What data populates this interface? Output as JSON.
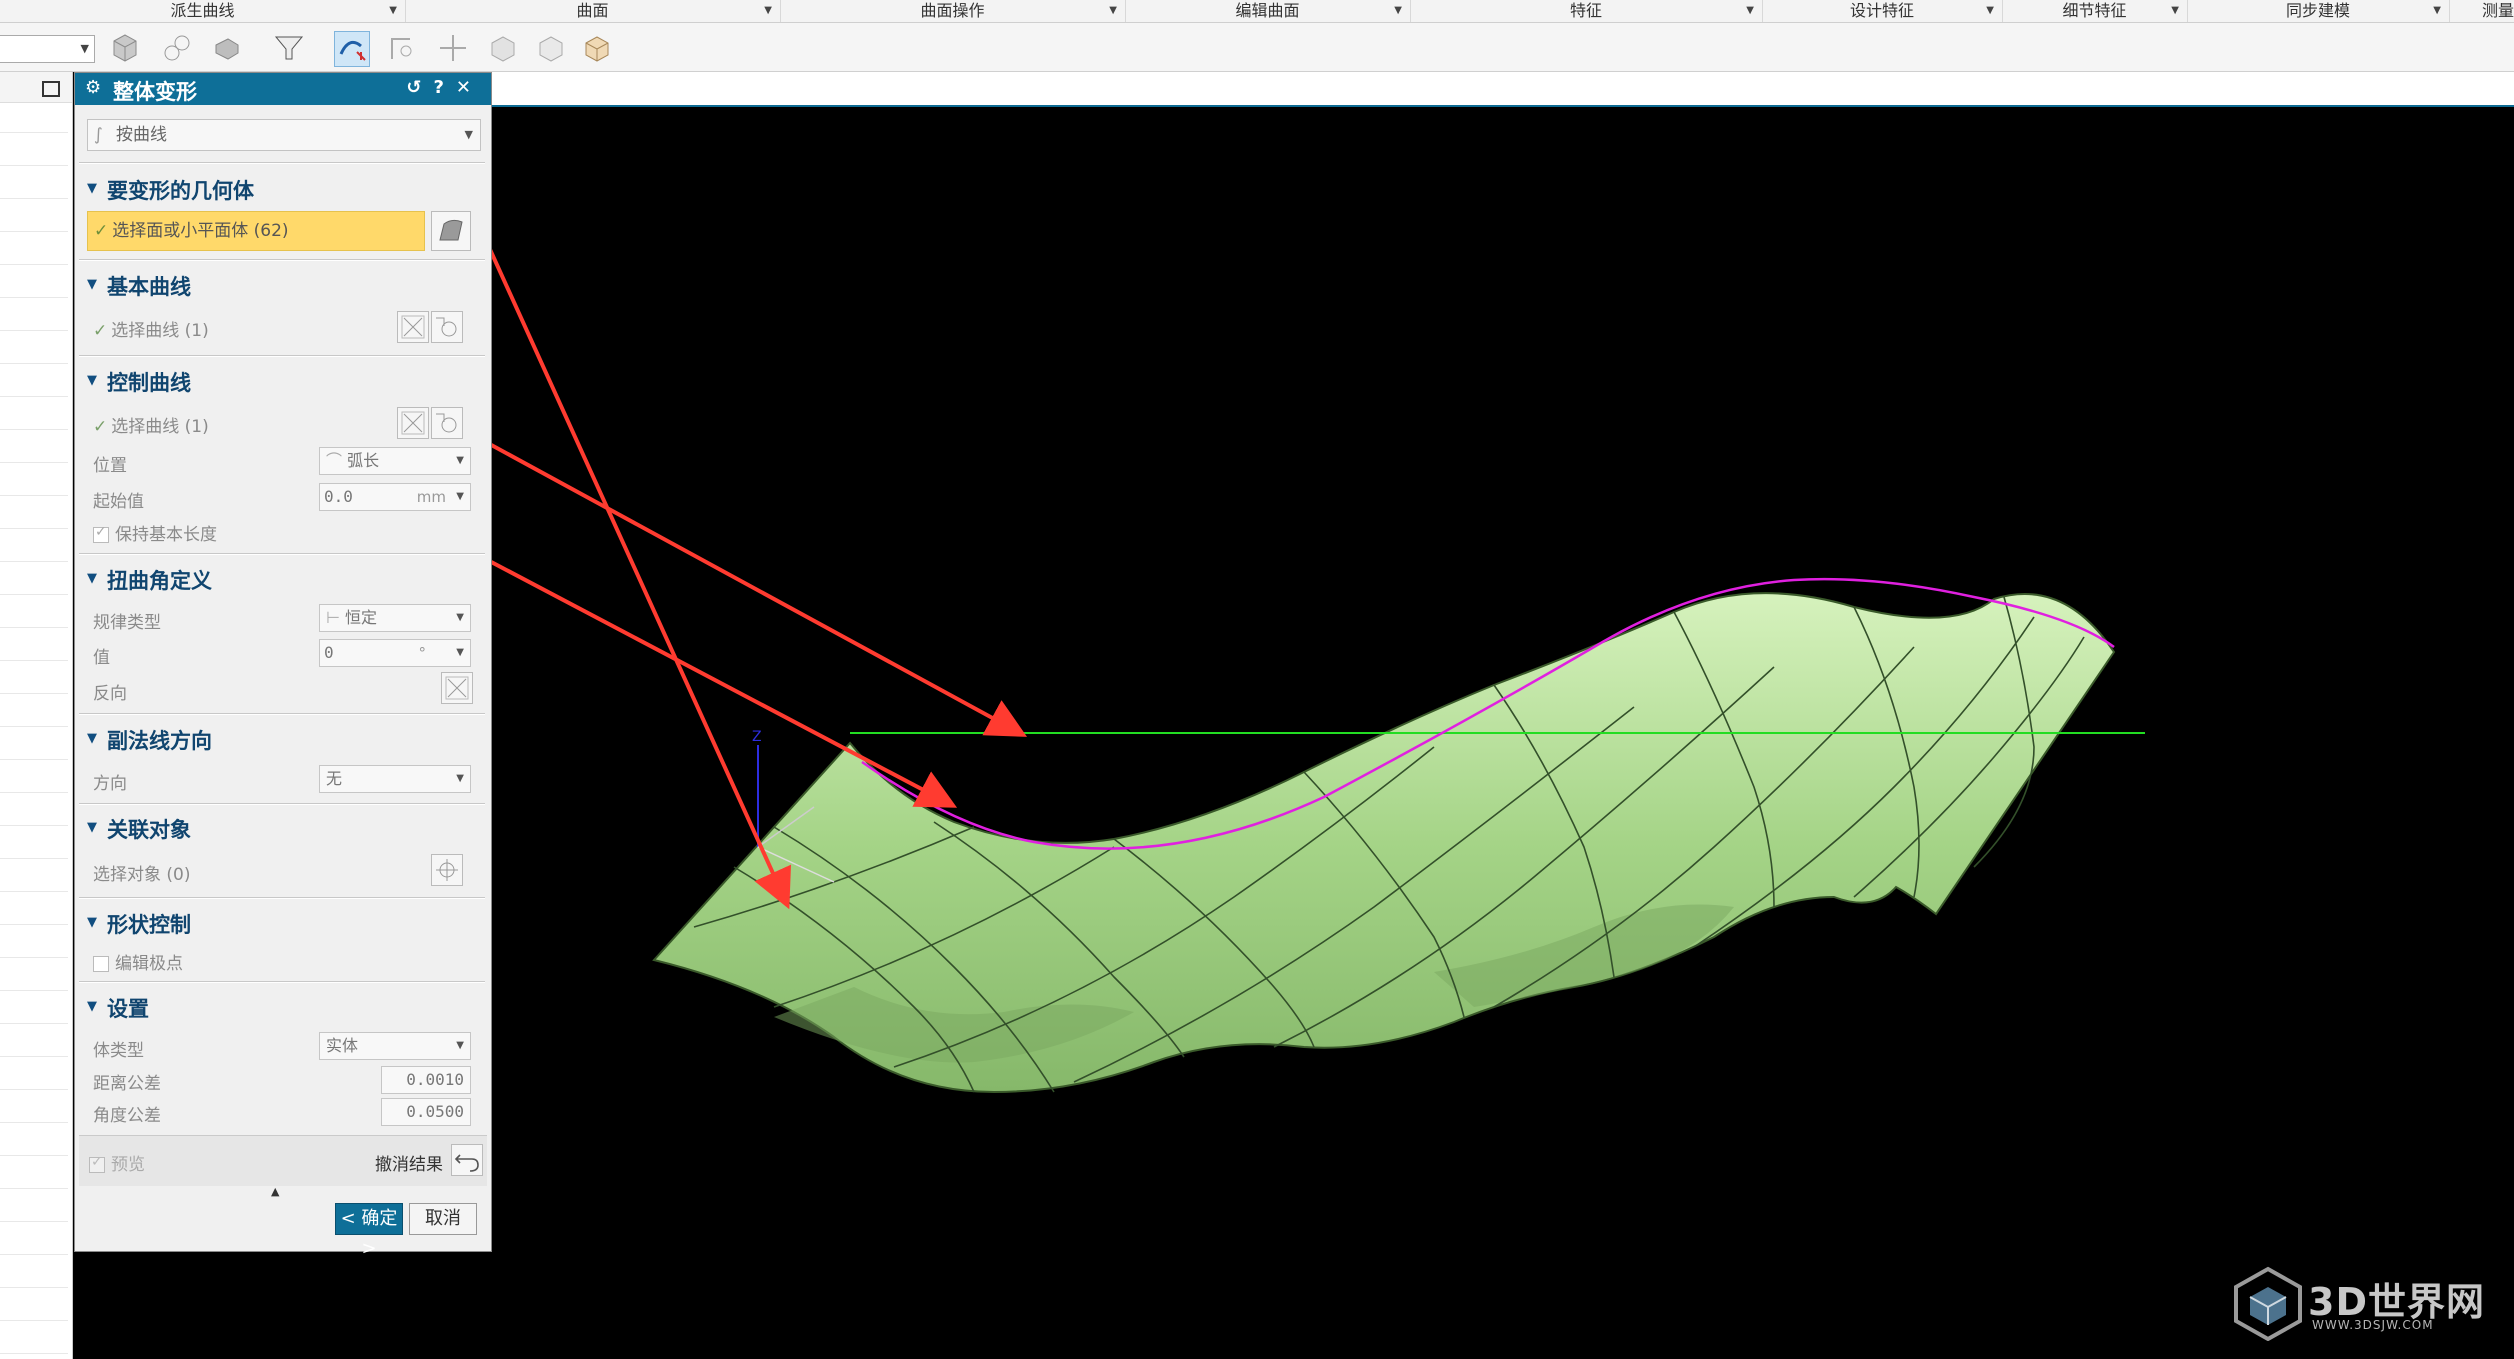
{
  "ribbon": {
    "groups": [
      "派生曲线",
      "曲面",
      "曲面操作",
      "编辑曲面",
      "特征",
      "设计特征",
      "细节特征",
      "同步建模",
      "测量"
    ]
  },
  "dialog": {
    "title": "整体变形",
    "title_buttons": [
      "↺",
      "?",
      "✕"
    ],
    "type_value": "按曲线",
    "sections": {
      "geometry": {
        "title": "要变形的几何体",
        "select_label": "选择面或小平面体 (62)"
      },
      "base_curve": {
        "title": "基本曲线",
        "select_label": "选择曲线 (1)"
      },
      "control_curve": {
        "title": "控制曲线",
        "select_label": "选择曲线 (1)",
        "position_label": "位置",
        "position_value": "弧长",
        "start_label": "起始值",
        "start_value": "0.0",
        "start_unit": "mm",
        "keep_length_label": "保持基本长度"
      },
      "twist": {
        "title": "扭曲角定义",
        "law_label": "规律类型",
        "law_value": "恒定",
        "value_label": "值",
        "value_value": "0",
        "value_unit": "°",
        "reverse_label": "反向"
      },
      "binormal": {
        "title": "副法线方向",
        "direction_label": "方向",
        "direction_value": "无"
      },
      "associated": {
        "title": "关联对象",
        "select_label": "选择对象 (0)"
      },
      "shape_control": {
        "title": "形状控制",
        "edit_poles_label": "编辑极点"
      },
      "settings": {
        "title": "设置",
        "body_type_label": "体类型",
        "body_type_value": "实体",
        "dist_tol_label": "距离公差",
        "dist_tol_value": "0.0010",
        "angle_tol_label": "角度公差",
        "angle_tol_value": "0.0500"
      }
    },
    "preview_label": "预览",
    "undo_result_label": "撤消结果",
    "ok_label": "< 确定 >",
    "cancel_label": "取消"
  },
  "viewport": {
    "background": "#000000",
    "surface_color": "#a8d88a",
    "control_curve_color": "#e020e0",
    "base_curve_color": "#22dd22",
    "arrow_color": "#ff3b30",
    "axis_label": "Z"
  },
  "watermark": {
    "brand": "3D世界网",
    "url": "WWW.3DSJW.COM"
  }
}
